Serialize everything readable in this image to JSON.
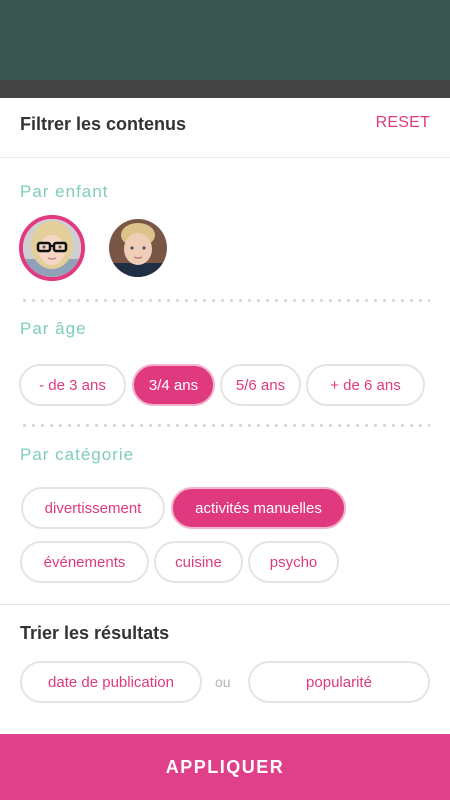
{
  "header": {
    "title": "Filtrer les contenus",
    "reset_label": "RESET"
  },
  "children_section": {
    "label": "Par enfant",
    "children": [
      {
        "icon": "girl-avatar",
        "selected": true
      },
      {
        "icon": "boy-avatar",
        "selected": false
      }
    ]
  },
  "age_section": {
    "label": "Par âge",
    "options": [
      "- de 3 ans",
      "3/4 ans",
      "5/6 ans",
      "+ de 6 ans"
    ],
    "selected": "3/4 ans"
  },
  "category_section": {
    "label": "Par catégorie",
    "options": [
      "divertissement",
      "activités manuelles",
      "événements",
      "cuisine",
      "psycho"
    ],
    "selected": "activités manuelles"
  },
  "sort_section": {
    "title": "Trier les résultats",
    "options": [
      "date de publication",
      "popularité"
    ],
    "separator": "ou"
  },
  "apply_label": "APPLIQUER",
  "colors": {
    "accent": "#e0397f",
    "section_label": "#7ecdbb",
    "backdrop": "#3b5550"
  }
}
